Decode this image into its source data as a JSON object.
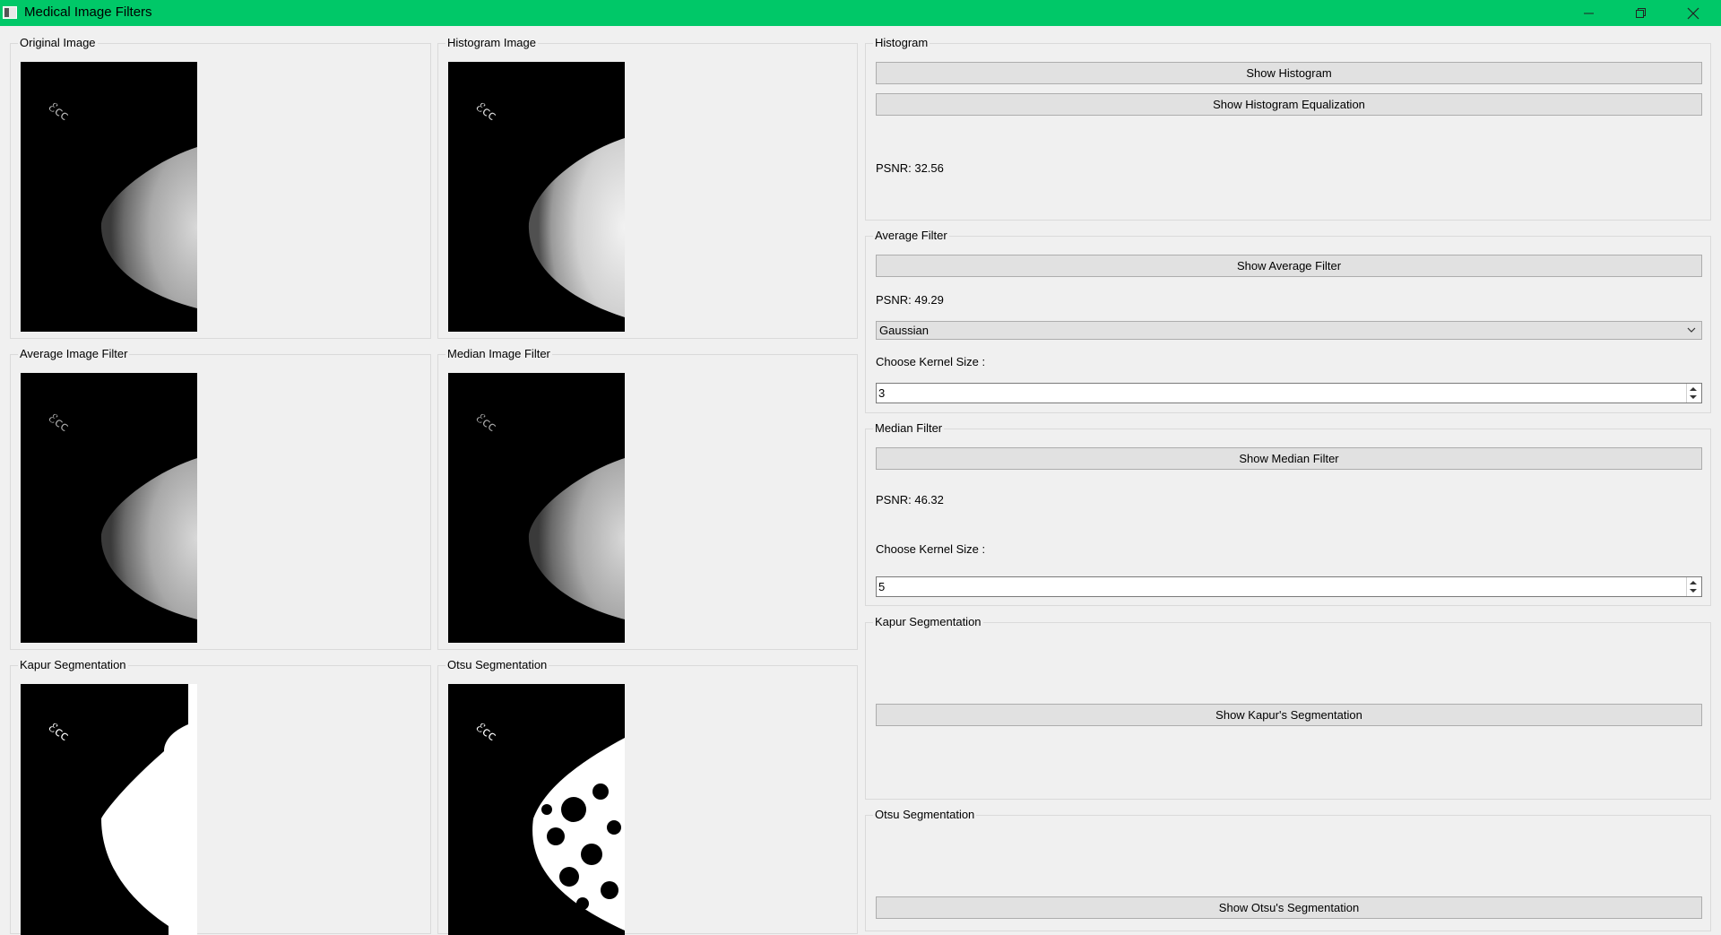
{
  "window": {
    "title": "Medical Image Filters"
  },
  "images": {
    "original": "Original Image",
    "histogram": "Histogram Image",
    "average": "Average Image Filter",
    "median": "Median Image Filter",
    "kapur": "Kapur Segmentation",
    "otsu": "Otsu Segmentation"
  },
  "histogram": {
    "title": "Histogram",
    "show_button": "Show Histogram",
    "equalization_button": "Show Histogram Equalization",
    "psnr": "PSNR: 32.56"
  },
  "average_filter": {
    "title": "Average Filter",
    "show_button": "Show Average Filter",
    "psnr": "PSNR: 49.29",
    "filter_type": "Gaussian",
    "kernel_label": "Choose Kernel Size :",
    "kernel_value": "3"
  },
  "median_filter": {
    "title": "Median Filter",
    "show_button": "Show Median Filter",
    "psnr": "PSNR: 46.32",
    "kernel_label": "Choose Kernel Size :",
    "kernel_value": "5"
  },
  "kapur": {
    "title": "Kapur Segmentation",
    "show_button": "Show Kapur's Segmentation"
  },
  "otsu": {
    "title": "Otsu Segmentation",
    "show_button": "Show Otsu's Segmentation"
  }
}
